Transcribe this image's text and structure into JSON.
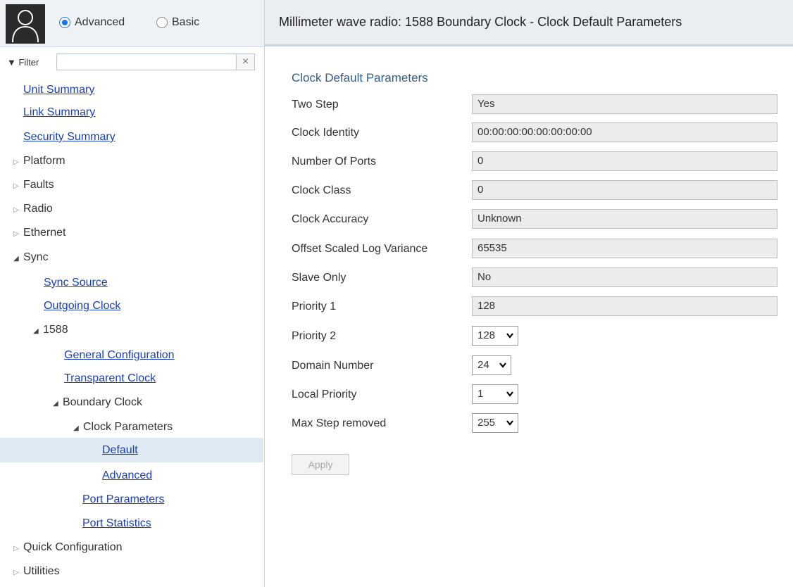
{
  "mode": {
    "advanced_label": "Advanced",
    "basic_label": "Basic",
    "selected": "Advanced"
  },
  "filter": {
    "label": "▼ Filter",
    "value": "",
    "clear_glyph": "×"
  },
  "nav": {
    "unit_summary": "Unit Summary",
    "link_summary": "Link Summary",
    "security_summary": "Security Summary",
    "platform": "Platform",
    "faults": "Faults",
    "radio": "Radio",
    "ethernet": "Ethernet",
    "sync": "Sync",
    "sync_source": "Sync Source",
    "outgoing_clock": "Outgoing Clock",
    "n1588": "1588",
    "general_configuration": "General Configuration",
    "transparent_clock": "Transparent Clock",
    "boundary_clock": "Boundary Clock",
    "clock_parameters": "Clock Parameters",
    "default": "Default",
    "advanced": "Advanced",
    "port_parameters": "Port Parameters",
    "port_statistics": "Port Statistics",
    "quick_configuration": "Quick Configuration",
    "utilities": "Utilities"
  },
  "page": {
    "title": "Millimeter wave radio: 1588 Boundary Clock - Clock Default Parameters",
    "section_title": "Clock Default Parameters"
  },
  "fields": {
    "two_step": {
      "label": "Two Step",
      "value": "Yes"
    },
    "clock_identity": {
      "label": "Clock Identity",
      "value": "00:00:00:00:00:00:00:00"
    },
    "number_of_ports": {
      "label": "Number Of Ports",
      "value": "0"
    },
    "clock_class": {
      "label": "Clock Class",
      "value": "0"
    },
    "clock_accuracy": {
      "label": "Clock Accuracy",
      "value": "Unknown"
    },
    "offset_scaled_log_variance": {
      "label": "Offset Scaled Log Variance",
      "value": "65535"
    },
    "slave_only": {
      "label": "Slave Only",
      "value": "No"
    },
    "priority_1": {
      "label": "Priority 1",
      "value": "128"
    },
    "priority_2": {
      "label": "Priority 2",
      "value": "128"
    },
    "domain_number": {
      "label": "Domain Number",
      "value": "24"
    },
    "local_priority": {
      "label": "Local Priority",
      "value": "1"
    },
    "max_step_removed": {
      "label": "Max Step removed",
      "value": "255"
    }
  },
  "apply_label": "Apply",
  "icons": {
    "tree_collapsed": "▷",
    "tree_expanded": "◢",
    "select_chevron": "❯"
  },
  "colors": {
    "link": "#1a3fb8",
    "selected_row": "#dfe9f3",
    "header_bg": "#e9eef3",
    "radio_accent": "#1a73e8"
  }
}
